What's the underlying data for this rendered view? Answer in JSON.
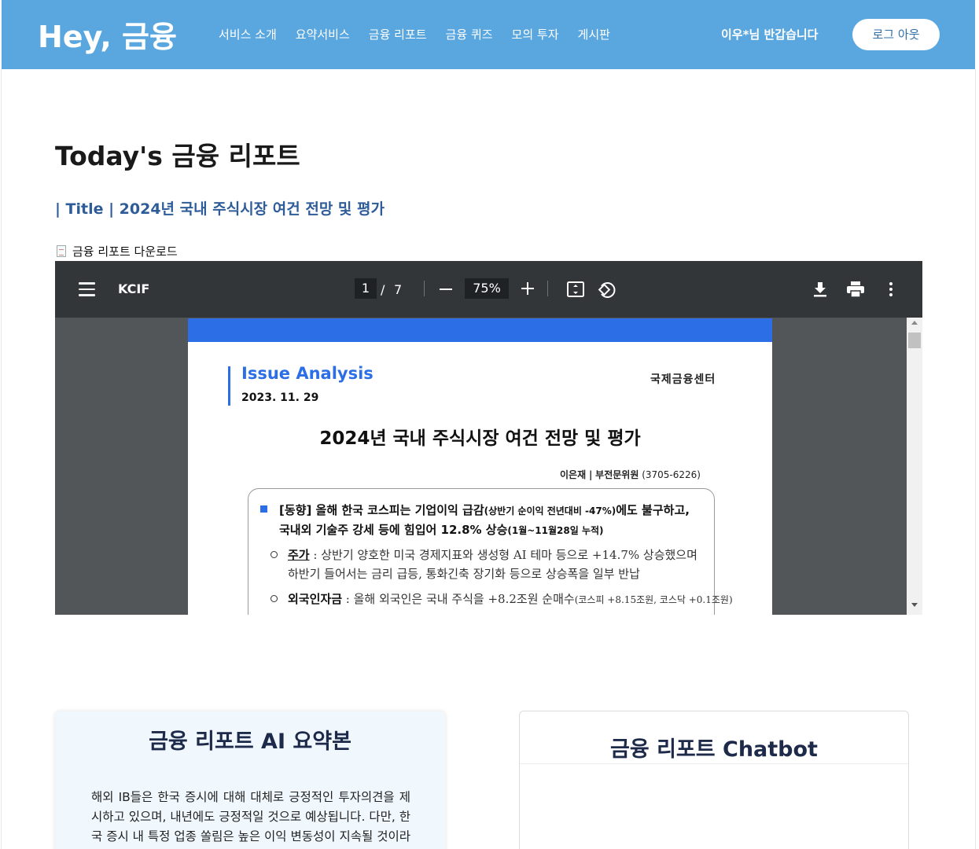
{
  "header": {
    "logo": "Hey, 금융",
    "nav": [
      "서비스 소개",
      "요약서비스",
      "금융 리포트",
      "금융 퀴즈",
      "모의 투자",
      "게시판"
    ],
    "greeting": "이우*님 반갑습니다",
    "logout_label": "로그 아웃"
  },
  "main": {
    "title": "Today's 금융 리포트",
    "subtitle": "| Title | 2024년 국내 주식시장 여건 전망 및 평가",
    "download_label": "금융 리포트 다운로드"
  },
  "pdf_viewer": {
    "doc_name": "KCIF",
    "current_page": "1",
    "page_separator": "/",
    "total_pages": "7",
    "zoom": "75%",
    "page": {
      "section": "Issue Analysis",
      "date": "2023. 11. 29",
      "org": "국제금융센터",
      "title": "2024년 국내 주식시장 여건 전망 및 평가",
      "author": "이은재",
      "author_role": "부전문위원",
      "author_phone": "(3705-6226)",
      "bullet_line1_a": "[동향] 올해 한국 코스피는 기업이익 급감",
      "bullet_line1_small": "(상반기 순이익 전년대비 -47%)",
      "bullet_line1_b": "에도 불구하고,",
      "bullet_line2_a": "국내외 기술주 강세 등에 힘입어 12.8% 상승",
      "bullet_line2_small": "(1월~11월28일 누적)",
      "sub1_key": "주가",
      "sub1_text": ": 상반기 양호한 미국 경제지표와 생성형 AI 테마 등으로 +14.7% 상승했으며",
      "sub1_text2": "하반기 들어서는 금리 급등, 통화긴축 장기화 등으로 상승폭을 일부 반납",
      "sub2_key": "외국인자금",
      "sub2_text": ": 올해 외국인은 국내 주식을 +8.2조원 순매수",
      "sub2_small": "(코스피 +8.15조원, 코스닥 +0.1조원)"
    }
  },
  "summary_card": {
    "title": "금융 리포트 AI 요약본",
    "text": "해외 IB들은 한국 증시에 대해 대체로 긍정적인 투자의견을 제시하고 있으며, 내년에도 긍정적일 것으로 예상됩니다. 다만, 한국 증시 내 특정 업종 쏠림은 높은 이익 변동성이 지속될 것이라 여겨 보았으며 이에 주주선의 실태 등 공"
  },
  "chatbot_card": {
    "title": "금융 리포트 Chatbot"
  },
  "colors": {
    "header_bg": "#5aa7e0",
    "accent_blue": "#2b6ee6",
    "subtitle_blue": "#2e5c99",
    "toolbar_bg": "#323639",
    "viewer_bg": "#525659"
  },
  "icons": [
    "menu-icon",
    "minus-icon",
    "plus-icon",
    "fit-page-icon",
    "rotate-icon",
    "download-icon",
    "print-icon",
    "more-vert-icon",
    "document-icon"
  ]
}
